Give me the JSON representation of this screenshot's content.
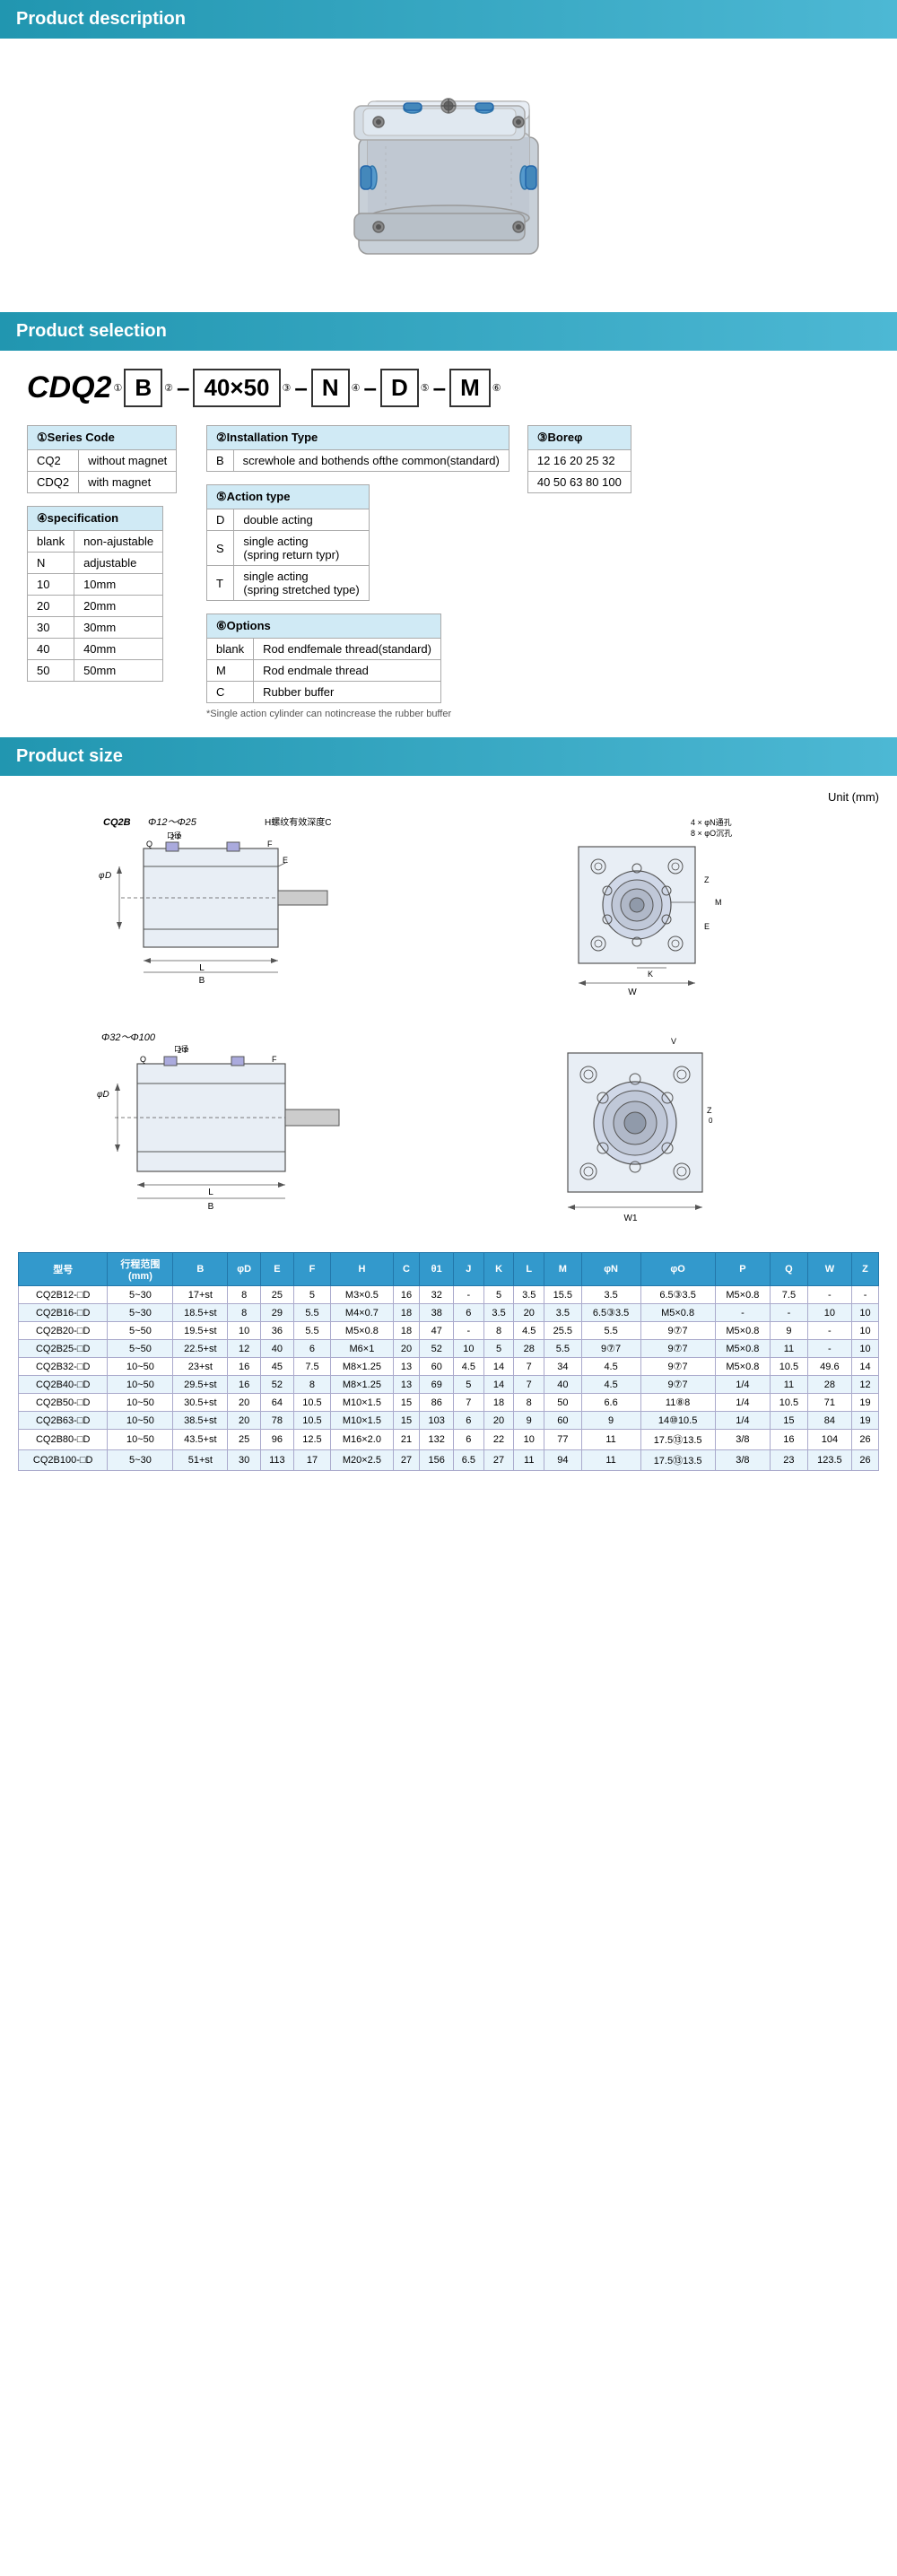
{
  "sections": {
    "description": "Product description",
    "selection": "Product selection",
    "size": "Product size"
  },
  "model": {
    "prefix": "CDQ2",
    "parts": [
      "B",
      "40×50",
      "N",
      "D",
      "M"
    ],
    "dashes": [
      "-",
      "-",
      "-",
      "-"
    ],
    "circle_numbers": [
      "①",
      "②",
      "③",
      "④",
      "⑤",
      "⑥"
    ]
  },
  "series_code": {
    "title": "①Series Code",
    "rows": [
      {
        "code": "CQ2",
        "desc": "without magnet"
      },
      {
        "code": "CDQ2",
        "desc": "with magnet"
      }
    ]
  },
  "installation_type": {
    "title": "②Installation Type",
    "rows": [
      {
        "code": "B",
        "desc": "screwhole and bothends ofthe common(standard)"
      }
    ]
  },
  "bore": {
    "title": "③Boreφ",
    "values1": "12  16  20  25  32",
    "values2": "40  50  63  80  100"
  },
  "specification": {
    "title": "④specification",
    "rows": [
      {
        "code": "blank",
        "desc": "non-ajustable"
      },
      {
        "code": "N",
        "desc": "adjustable"
      },
      {
        "code": "10",
        "desc": "10mm"
      },
      {
        "code": "20",
        "desc": "20mm"
      },
      {
        "code": "30",
        "desc": "30mm"
      },
      {
        "code": "40",
        "desc": "40mm"
      },
      {
        "code": "50",
        "desc": "50mm"
      }
    ]
  },
  "action_type": {
    "title": "⑤Action type",
    "rows": [
      {
        "code": "D",
        "desc": "double acting"
      },
      {
        "code": "S",
        "desc": "single acting (spring return typr)"
      },
      {
        "code": "T",
        "desc": "single acting (spring stretched type)"
      }
    ]
  },
  "options": {
    "title": "⑥Options",
    "rows": [
      {
        "code": "blank",
        "desc": "Rod endfemale thread(standard)"
      },
      {
        "code": "M",
        "desc": "Rod endmale thread"
      },
      {
        "code": "C",
        "desc": "Rubber buffer"
      }
    ],
    "note": "*Single action cylinder can notincrease the rubber buffer"
  },
  "unit": "Unit (mm)",
  "size_table": {
    "headers": [
      "型号",
      "行程范围(mm)",
      "B",
      "φD",
      "E",
      "F",
      "H",
      "C",
      "θ1",
      "J",
      "K",
      "L",
      "M",
      "φN",
      "φO",
      "P",
      "Q",
      "W",
      "Z"
    ],
    "rows": [
      {
        "model": "CQ2B12-□D",
        "stroke": "5~30",
        "B": "17+st",
        "D": "8",
        "E": "25",
        "F": "5",
        "H": "M3×0.5",
        "C": "16",
        "t1": "32",
        "J": "-",
        "K": "5",
        "L": "3.5",
        "M": "15.5",
        "N": "3.5",
        "O": "6.5③3.5",
        "P": "M5×0.8",
        "Q": "7.5",
        "W": "-",
        "Z": "-"
      },
      {
        "model": "CQ2B16-□D",
        "stroke": "5~30",
        "B": "18.5+st",
        "D": "8",
        "E": "29",
        "F": "5.5",
        "H": "M4×0.7",
        "C": "18",
        "t1": "38",
        "J": "6",
        "K": "3.5",
        "L": "20",
        "M": "3.5",
        "N": "6.5③3.5",
        "O": "M5×0.8",
        "P": "-",
        "Q": "-",
        "W": "10",
        "Z": "10"
      },
      {
        "model": "CQ2B20-□D",
        "stroke": "5~50",
        "B": "19.5+st",
        "D": "10",
        "E": "36",
        "F": "5.5",
        "H": "M5×0.8",
        "C": "18",
        "t1": "47",
        "J": "-",
        "K": "8",
        "L": "4.5",
        "M": "25.5",
        "N": "5.5",
        "O": "9⑦7",
        "P": "M5×0.8",
        "Q": "9",
        "W": "-",
        "Z": "10"
      },
      {
        "model": "CQ2B25-□D",
        "stroke": "5~50",
        "B": "22.5+st",
        "D": "12",
        "E": "40",
        "F": "6",
        "H": "M6×1",
        "C": "20",
        "t1": "52",
        "J": "10",
        "K": "5",
        "L": "28",
        "M": "5.5",
        "N": "9⑦7",
        "O": "9⑦7",
        "P": "M5×0.8",
        "Q": "11",
        "W": "-",
        "Z": "10"
      },
      {
        "model": "CQ2B32-□D",
        "stroke": "10~50",
        "B": "23+st",
        "D": "16",
        "E": "45",
        "F": "7.5",
        "H": "M8×1.25",
        "C": "13",
        "t1": "60",
        "J": "4.5",
        "K": "14",
        "L": "7",
        "M": "34",
        "N": "4.5",
        "O": "9⑦7",
        "P": "M5×0.8",
        "Q": "10.5",
        "W": "49.6",
        "Z": "14"
      },
      {
        "model": "CQ2B40-□D",
        "stroke": "10~50",
        "B": "29.5+st",
        "D": "16",
        "E": "52",
        "F": "8",
        "H": "M8×1.25",
        "C": "13",
        "t1": "69",
        "J": "5",
        "K": "14",
        "L": "7",
        "M": "40",
        "N": "4.5",
        "O": "9⑦7",
        "P": "1/4",
        "Q": "11",
        "W": "28",
        "Z": "12"
      },
      {
        "model": "CQ2B50-□D",
        "stroke": "10~50",
        "B": "30.5+st",
        "D": "20",
        "E": "64",
        "F": "10.5",
        "H": "M10×1.5",
        "C": "15",
        "t1": "86",
        "J": "7",
        "K": "18",
        "L": "8",
        "M": "50",
        "N": "6.6",
        "O": "11⑧8",
        "P": "1/4",
        "Q": "10.5",
        "W": "71",
        "Z": "19"
      },
      {
        "model": "CQ2B63-□D",
        "stroke": "10~50",
        "B": "38.5+st",
        "D": "20",
        "E": "78",
        "F": "10.5",
        "H": "M10×1.5",
        "C": "15",
        "t1": "103",
        "J": "6",
        "K": "20",
        "L": "9",
        "M": "60",
        "N": "9",
        "O": "14⑩10.5",
        "P": "1/4",
        "Q": "15",
        "W": "84",
        "Z": "19"
      },
      {
        "model": "CQ2B80-□D",
        "stroke": "10~50",
        "B": "43.5+st",
        "D": "25",
        "E": "96",
        "F": "12.5",
        "H": "M16×2.0",
        "C": "21",
        "t1": "132",
        "J": "6",
        "K": "22",
        "L": "10",
        "M": "77",
        "N": "11",
        "O": "17.5⑬13.5",
        "P": "3/8",
        "Q": "16",
        "W": "104",
        "Z": "26"
      },
      {
        "model": "CQ2B100-□D",
        "stroke": "5~30",
        "B": "51+st",
        "D": "30",
        "E": "113",
        "F": "17",
        "H": "M20×2.5",
        "C": "27",
        "t1": "156",
        "J": "6.5",
        "K": "27",
        "L": "11",
        "M": "94",
        "N": "11",
        "O": "17.5⑬13.5",
        "P": "3/8",
        "Q": "23",
        "W": "123.5",
        "Z": "26"
      }
    ]
  }
}
